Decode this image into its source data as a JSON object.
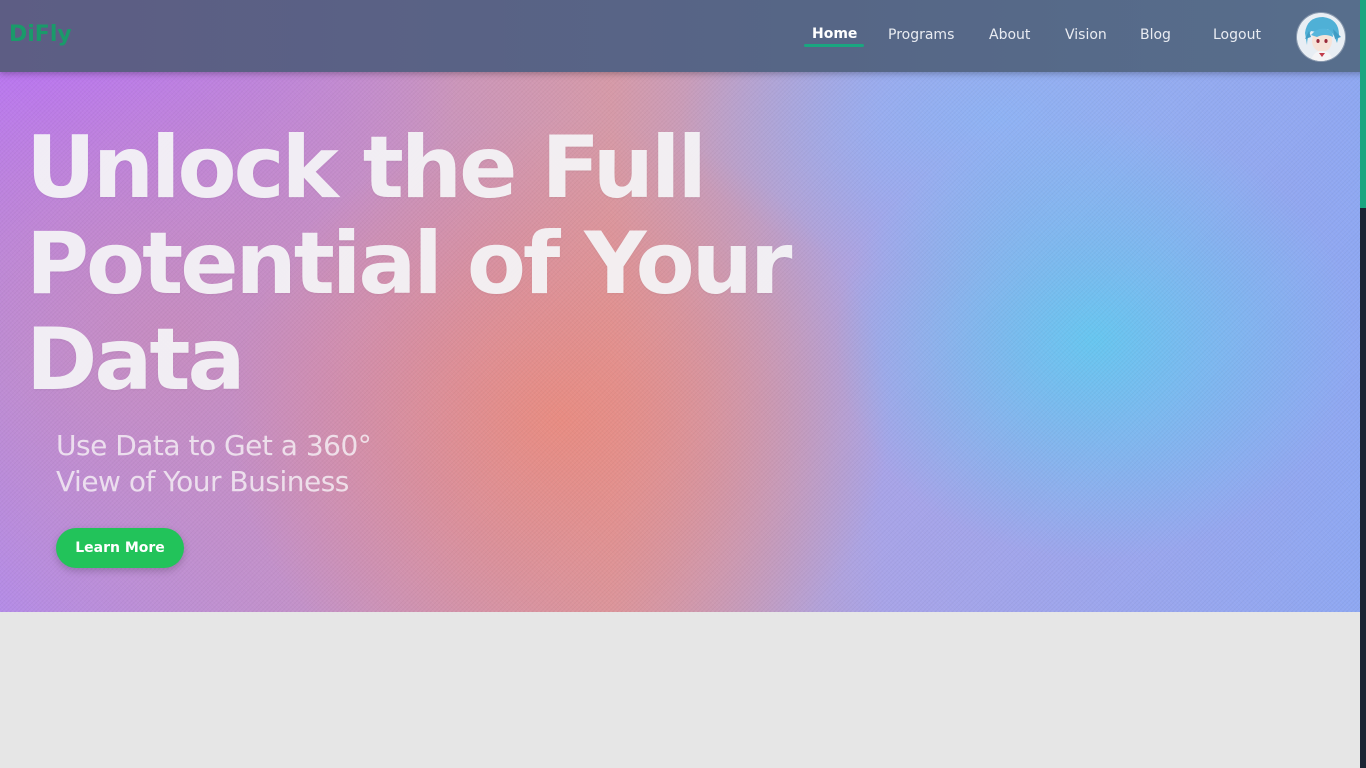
{
  "brand": {
    "logo_text": "DiFly",
    "logo_color": "#1a9a6a"
  },
  "nav": {
    "items": [
      {
        "label": "Home",
        "active": true
      },
      {
        "label": "Programs",
        "active": false
      },
      {
        "label": "About",
        "active": false
      },
      {
        "label": "Vision",
        "active": false
      },
      {
        "label": "Blog",
        "active": false
      },
      {
        "label": "Logout",
        "active": false
      }
    ],
    "accent_color": "#1aa680",
    "avatar_icon": "user-avatar-icon"
  },
  "hero": {
    "headline_line1": "Unlock the Full",
    "headline_line2": "Potential of Your",
    "headline_line3": "Data",
    "subhead_line1": "Use Data to Get a 360°",
    "subhead_line2": "View of Your Business",
    "cta_label": "Learn More",
    "cta_color": "#22c35a"
  }
}
